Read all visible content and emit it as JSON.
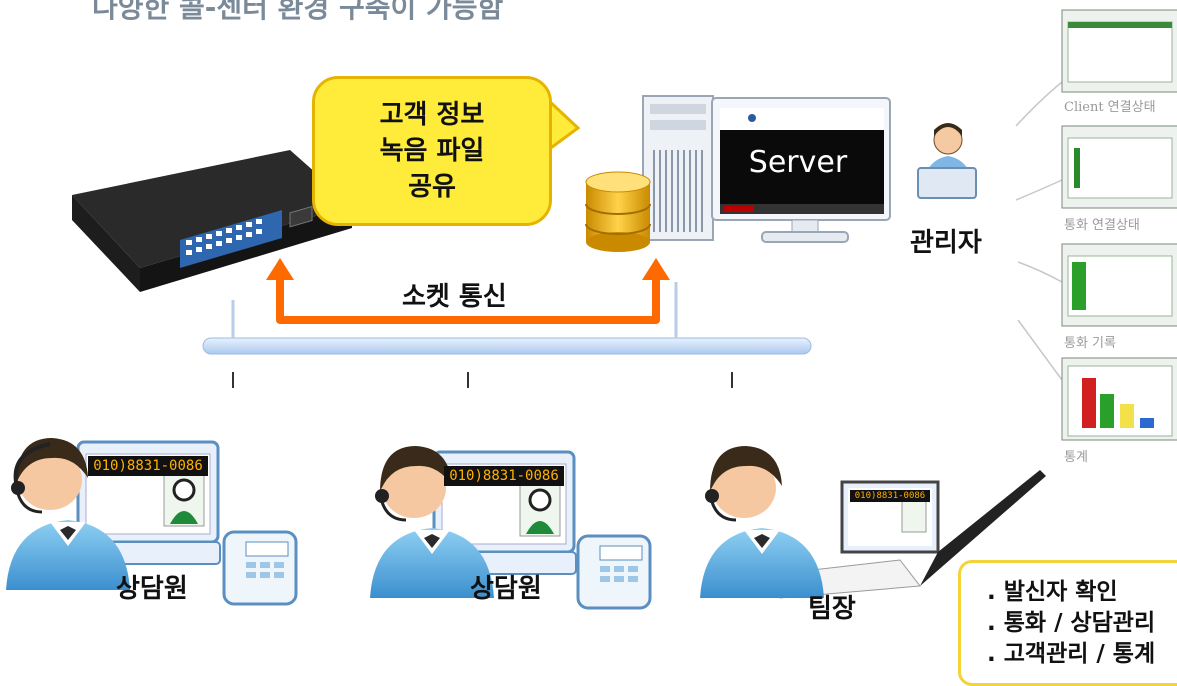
{
  "header": {
    "title": "다양한 콜-센터 환경 구축이 가능함"
  },
  "bubble": {
    "lines": [
      "고객 정보",
      "녹음 파일",
      "공유"
    ]
  },
  "server": {
    "label": "Server"
  },
  "admin": {
    "label": "관리자"
  },
  "network": {
    "socket_label": "소켓 통신"
  },
  "stations": [
    {
      "label": "상담원",
      "phone_number": "010)8831-0086"
    },
    {
      "label": "상담원",
      "phone_number": "010)8831-0086"
    },
    {
      "label": "팀장",
      "phone_number": "010)8831-0086"
    }
  ],
  "side_panel": {
    "captions": [
      "Client 연결상태",
      "통화 연결상태",
      "통화 기록",
      "통계"
    ]
  },
  "features": {
    "items": [
      ". 발신자 확인",
      ". 통화 / 상담관리",
      ". 고객관리 / 통계"
    ]
  },
  "colors": {
    "arrow": "#ff6a00",
    "bubble": "#ffec3a",
    "bus": "#c9defa",
    "agent": "#5aa8de"
  }
}
